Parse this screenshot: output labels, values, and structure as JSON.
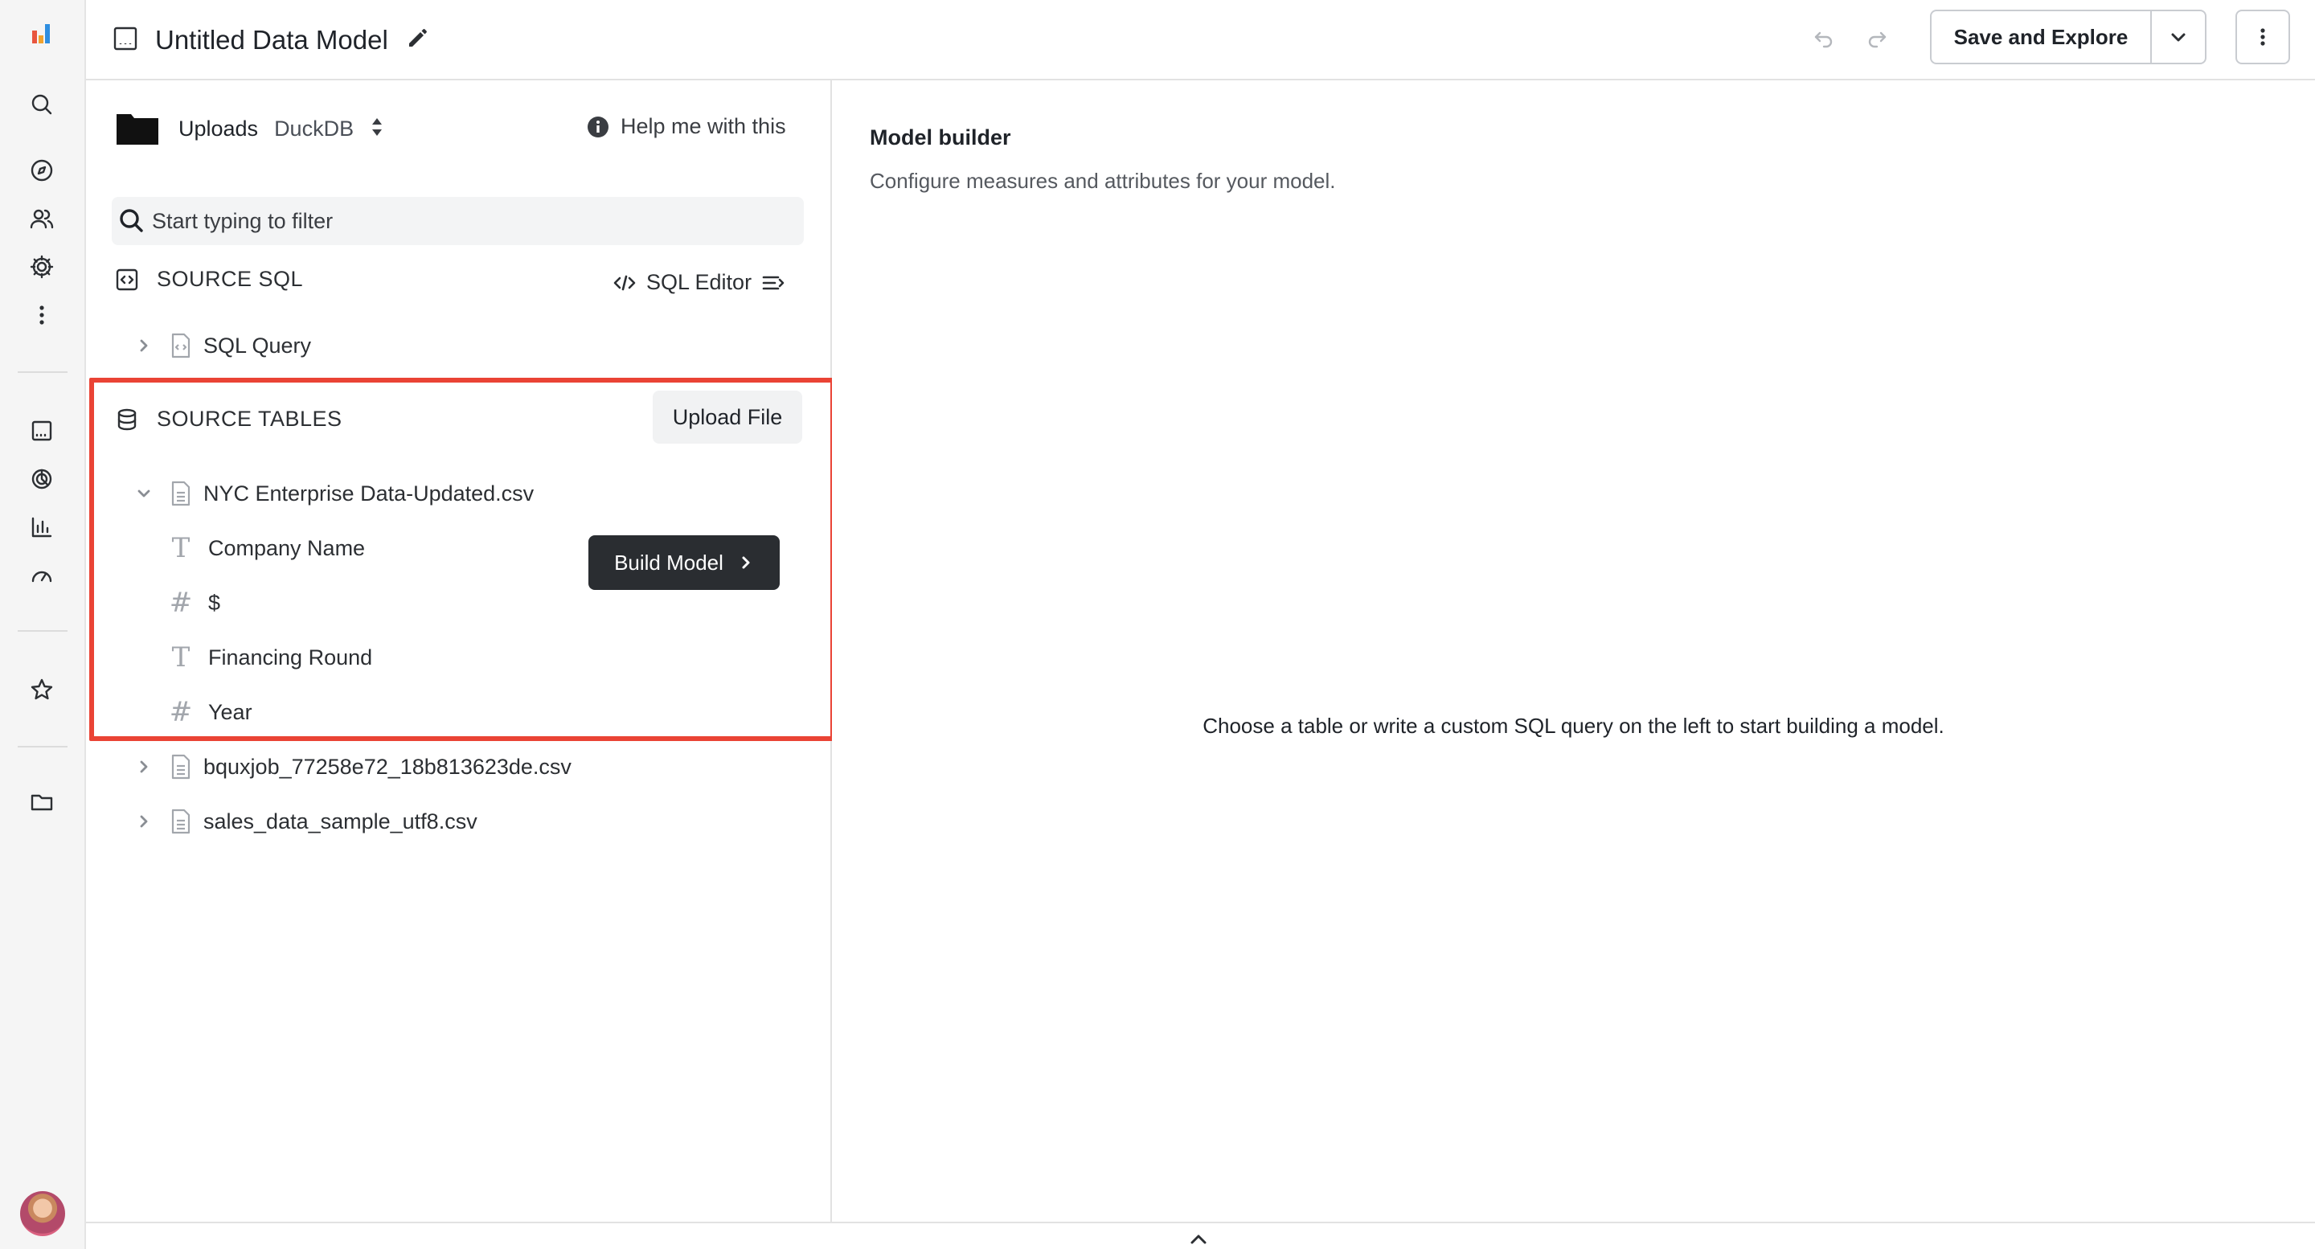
{
  "app": {
    "logo_icon": "bar-logo-icon",
    "brand_colors": [
      "#e8553e",
      "#2f8ee0",
      "#f0a22e"
    ]
  },
  "nav": {
    "icons": [
      "search-icon",
      "compass-icon",
      "users-icon",
      "gear-icon",
      "more-vertical-icon",
      "dashboard-icon",
      "explore-icon",
      "chart-icon",
      "gauge-icon",
      "star-icon",
      "folder-icon"
    ]
  },
  "header": {
    "title": "Untitled Data Model",
    "save_label": "Save and Explore"
  },
  "source": {
    "folder_name": "Uploads",
    "database": "DuckDB",
    "help_label": "Help me with this",
    "filter_placeholder": "Start typing to filter"
  },
  "sql_section": {
    "heading": "SOURCE SQL",
    "editor_label": "SQL Editor",
    "query_label": "SQL Query"
  },
  "tables_section": {
    "heading": "SOURCE TABLES",
    "upload_label": "Upload File",
    "build_label": "Build Model",
    "highlight_color": "#ea4335",
    "expanded_table": "NYC Enterprise Data-Updated.csv",
    "fields": [
      {
        "type_glyph": "T",
        "type_icon": "text-type-icon",
        "name": "Company Name"
      },
      {
        "type_glyph": "#",
        "type_icon": "number-type-icon",
        "name": "$"
      },
      {
        "type_glyph": "T",
        "type_icon": "text-type-icon",
        "name": "Financing Round"
      },
      {
        "type_glyph": "#",
        "type_icon": "number-type-icon",
        "name": "Year"
      }
    ],
    "other_tables": [
      "bquxjob_77258e72_18b813623de.csv",
      "sales_data_sample_utf8.csv"
    ]
  },
  "builder": {
    "title": "Model builder",
    "subtitle": "Configure measures and attributes for your model.",
    "empty_message": "Choose a table or write a custom SQL query on the left to start building a model."
  }
}
